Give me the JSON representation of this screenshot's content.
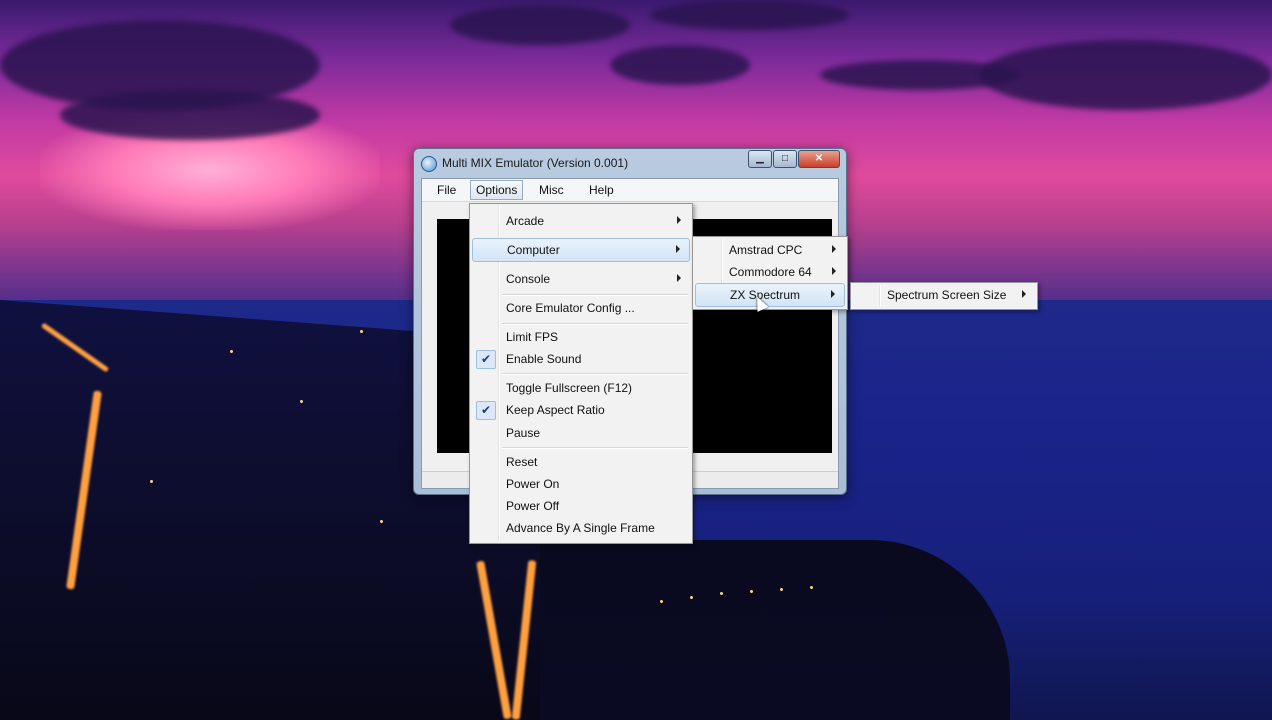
{
  "window": {
    "title": "Multi MIX Emulator (Version 0.001)",
    "minimize_glyph": "▁",
    "maximize_glyph": "□",
    "close_glyph": "✕"
  },
  "menubar": {
    "items": [
      "File",
      "Options",
      "Misc",
      "Help"
    ],
    "active": "Options"
  },
  "options_menu": {
    "items": [
      {
        "label": "Arcade",
        "submenu": true
      },
      {
        "label": "Computer",
        "submenu": true,
        "highlighted": true
      },
      {
        "label": "Console",
        "submenu": true
      },
      {
        "label": "Core Emulator Config ..."
      },
      {
        "label": "Limit FPS"
      },
      {
        "label": "Enable Sound",
        "checked": true
      },
      {
        "label": "Toggle Fullscreen (F12)"
      },
      {
        "label": "Keep Aspect Ratio",
        "checked": true
      },
      {
        "label": "Pause"
      },
      {
        "label": "Reset"
      },
      {
        "label": "Power On"
      },
      {
        "label": "Power Off"
      },
      {
        "label": "Advance By A Single Frame"
      }
    ]
  },
  "computer_menu": {
    "items": [
      {
        "label": "Amstrad CPC",
        "submenu": true
      },
      {
        "label": "Commodore 64",
        "submenu": true
      },
      {
        "label": "ZX Spectrum",
        "submenu": true,
        "highlighted": true
      }
    ]
  },
  "spectrum_menu": {
    "items": [
      {
        "label": "Spectrum Screen Size",
        "submenu": true
      }
    ]
  },
  "icons": {
    "check": "✔"
  }
}
